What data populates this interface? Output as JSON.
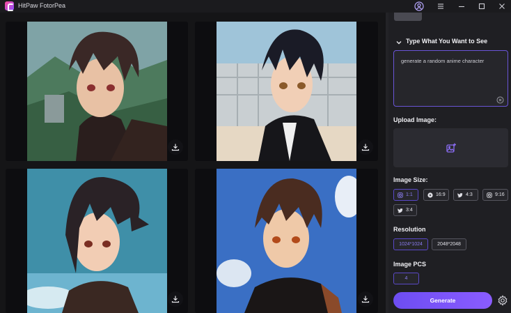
{
  "app": {
    "title": "HitPaw FotorPea"
  },
  "gallery": {
    "images": [
      {
        "name": "anime-boy-mountains",
        "download_icon": "download-icon"
      },
      {
        "name": "anime-boy-rooftop",
        "download_icon": "download-icon"
      },
      {
        "name": "anime-girl-sky",
        "download_icon": "download-icon"
      },
      {
        "name": "anime-boy-clouds",
        "download_icon": "download-icon"
      }
    ]
  },
  "panel": {
    "prompt_section_title": "Type What You Want to See",
    "prompt_text": "generate a random anime character",
    "upload_title": "Upload Image:",
    "size_title": "Image Size:",
    "sizes": [
      {
        "label": "1:1",
        "icon": "instagram-icon",
        "active": true
      },
      {
        "label": "16:9",
        "icon": "youtube-icon",
        "active": false
      },
      {
        "label": "4:3",
        "icon": "twitter-icon",
        "active": false
      },
      {
        "label": "9:16",
        "icon": "instagram-icon",
        "active": false
      },
      {
        "label": "3:4",
        "icon": "twitter-icon",
        "active": false
      }
    ],
    "resolution_title": "Resolution",
    "resolutions": [
      {
        "label": "1024*1024",
        "active": true
      },
      {
        "label": "2048*2048",
        "active": false
      }
    ],
    "pcs_title": "Image PCS",
    "pcs_value": "4",
    "generate_label": "Generate"
  },
  "colors": {
    "accent": "#6d4df2",
    "accent_text": "#8b7df0",
    "panel_bg": "#1f1f23",
    "window_bg": "#1b1b1e"
  }
}
